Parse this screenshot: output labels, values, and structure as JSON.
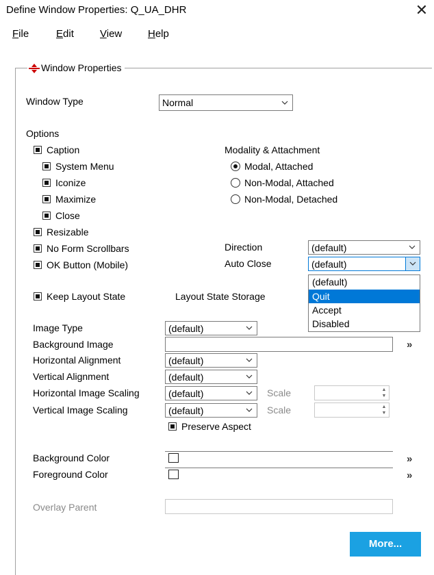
{
  "window": {
    "title": "Define Window Properties: Q_UA_DHR",
    "close_glyph": "✕"
  },
  "menu": {
    "items": [
      {
        "first": "F",
        "rest": "ile"
      },
      {
        "first": "E",
        "rest": "dit"
      },
      {
        "first": "V",
        "rest": "iew"
      },
      {
        "first": "H",
        "rest": "elp"
      }
    ]
  },
  "group": {
    "title": "Window Properties",
    "icon": "window-properties-icon"
  },
  "window_type": {
    "label": "Window Type",
    "value": "Normal"
  },
  "options": {
    "label": "Options",
    "caption": {
      "label": "Caption",
      "checked": true
    },
    "system_menu": {
      "label": "System Menu",
      "checked": true
    },
    "iconize": {
      "label": "Iconize",
      "checked": true
    },
    "maximize": {
      "label": "Maximize",
      "checked": true
    },
    "close": {
      "label": "Close",
      "checked": true
    },
    "resizable": {
      "label": "Resizable",
      "checked": true
    },
    "no_form_scrollbars": {
      "label": "No Form Scrollbars",
      "checked": true
    },
    "ok_button": {
      "label": "OK Button (Mobile)",
      "checked": true
    },
    "keep_layout_state": {
      "label": "Keep Layout State",
      "checked": true
    }
  },
  "modality": {
    "label": "Modality & Attachment",
    "options": [
      {
        "label": "Modal, Attached",
        "checked": true
      },
      {
        "label": "Non-Modal, Attached",
        "checked": false
      },
      {
        "label": "Non-Modal, Detached",
        "checked": false
      }
    ]
  },
  "direction": {
    "label": "Direction",
    "value": "(default)"
  },
  "auto_close": {
    "label": "Auto Close",
    "value": "(default)",
    "options": [
      "(default)",
      "Quit",
      "Accept",
      "Disabled"
    ],
    "highlighted": "Quit"
  },
  "layout_state_storage": {
    "label": "Layout State Storage"
  },
  "image": {
    "type": {
      "label": "Image Type",
      "value": "(default)"
    },
    "background": {
      "label": "Background Image",
      "value": ""
    },
    "h_align": {
      "label": "Horizontal Alignment",
      "value": "(default)"
    },
    "v_align": {
      "label": "Vertical Alignment",
      "value": "(default)"
    },
    "h_scaling": {
      "label": "Horizontal Image Scaling",
      "value": "(default)",
      "scale_label": "Scale"
    },
    "v_scaling": {
      "label": "Vertical Image Scaling",
      "value": "(default)",
      "scale_label": "Scale"
    },
    "preserve_aspect": {
      "label": "Preserve Aspect",
      "checked": true
    }
  },
  "colors": {
    "background": {
      "label": "Background Color"
    },
    "foreground": {
      "label": "Foreground Color"
    }
  },
  "overlay_parent": {
    "label": "Overlay Parent",
    "value": ""
  },
  "more_button": {
    "label": "More..."
  },
  "browse_glyph": "»",
  "accent": "#1ba1e2",
  "selection": "#0078d7"
}
